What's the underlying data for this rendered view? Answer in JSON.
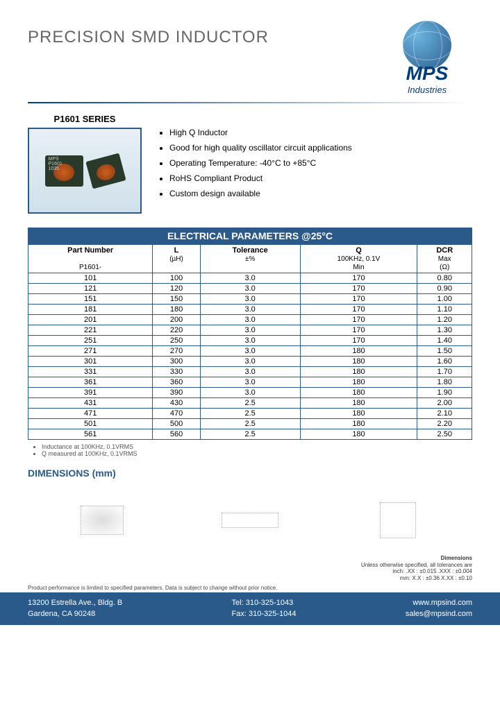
{
  "company": {
    "name": "MPS",
    "subtitle": "Industries"
  },
  "title": "PRECISION SMD  INDUCTOR",
  "series_label": "P1601 SERIES",
  "features": [
    "High Q Inductor",
    "Good for high quality oscillator circuit applications",
    "Operating Temperature: -40°C to +85°C",
    "RoHS Compliant Product",
    "Custom design available"
  ],
  "table": {
    "header": "ELECTRICAL PARAMETERS @25°C",
    "columns": {
      "part_number": {
        "label": "Part Number",
        "sub": "P1601-"
      },
      "l": {
        "label": "L",
        "sub": "(µH)"
      },
      "tolerance": {
        "label": "Tolerance",
        "sub": "±%"
      },
      "q": {
        "label": "Q",
        "sub": "100KHz, 0.1V\nMin"
      },
      "dcr": {
        "label": "DCR",
        "sub": "Max\n(Ω)"
      }
    },
    "rows": [
      {
        "pn": "101",
        "l": "100",
        "tol": "3.0",
        "q": "170",
        "dcr": "0.80"
      },
      {
        "pn": "121",
        "l": "120",
        "tol": "3.0",
        "q": "170",
        "dcr": "0.90"
      },
      {
        "pn": "151",
        "l": "150",
        "tol": "3.0",
        "q": "170",
        "dcr": "1.00"
      },
      {
        "pn": "181",
        "l": "180",
        "tol": "3.0",
        "q": "170",
        "dcr": "1.10"
      },
      {
        "pn": "201",
        "l": "200",
        "tol": "3.0",
        "q": "170",
        "dcr": "1.20"
      },
      {
        "pn": "221",
        "l": "220",
        "tol": "3.0",
        "q": "170",
        "dcr": "1.30"
      },
      {
        "pn": "251",
        "l": "250",
        "tol": "3.0",
        "q": "170",
        "dcr": "1.40"
      },
      {
        "pn": "271",
        "l": "270",
        "tol": "3.0",
        "q": "180",
        "dcr": "1.50"
      },
      {
        "pn": "301",
        "l": "300",
        "tol": "3.0",
        "q": "180",
        "dcr": "1.60"
      },
      {
        "pn": "331",
        "l": "330",
        "tol": "3.0",
        "q": "180",
        "dcr": "1.70"
      },
      {
        "pn": "361",
        "l": "360",
        "tol": "3.0",
        "q": "180",
        "dcr": "1.80"
      },
      {
        "pn": "391",
        "l": "390",
        "tol": "3.0",
        "q": "180",
        "dcr": "1.90"
      },
      {
        "pn": "431",
        "l": "430",
        "tol": "2.5",
        "q": "180",
        "dcr": "2.00"
      },
      {
        "pn": "471",
        "l": "470",
        "tol": "2.5",
        "q": "180",
        "dcr": "2.10"
      },
      {
        "pn": "501",
        "l": "500",
        "tol": "2.5",
        "q": "180",
        "dcr": "2.20"
      },
      {
        "pn": "561",
        "l": "560",
        "tol": "2.5",
        "q": "180",
        "dcr": "2.50"
      }
    ],
    "notes": [
      "Inductance at 100KHz, 0.1VRMS",
      "Q measured at 100KHz, 0.1VRMS"
    ]
  },
  "dimensions": {
    "title": "DIMENSIONS (mm)",
    "note_title": "Dimensions",
    "note_body": "Unless otherwise specified, all tolerances are\ninch: .XX : ±0.015    .XXX : ±0.004\nmm: X.X : ±0.36   X.XX : ±0.10"
  },
  "disclaimer": "Product performance is limited to specified parameters. Data is subject to change without prior notice.",
  "footer": {
    "address1": "13200 Estrella Ave., Bldg. B",
    "address2": "Gardena, CA 90248",
    "tel": "Tel: 310-325-1043",
    "fax": "Fax: 310-325-1044",
    "web": "www.mpsind.com",
    "email": "sales@mpsind.com"
  }
}
